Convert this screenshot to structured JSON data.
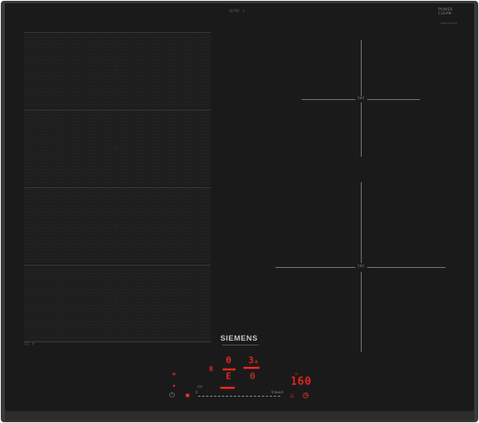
{
  "top_small_label": "iQ700 · s",
  "top_right_logo": {
    "line1": "POWER",
    "line2": "CLEAN"
  },
  "top_right_small": "EX675LYV1E",
  "flex_zone_marks": {
    "left": "|||",
    "right": "/⁄‑"
  },
  "zone_marks": {
    "upper": "(≡)",
    "lower": "(≡)"
  },
  "brand": "SIEMENS",
  "displays": {
    "left_zone_level": "8",
    "upper_zone_level": "0",
    "upper_right_level": "3",
    "upper_right_sub": "a",
    "middle_level": "E",
    "middle_right_level": "0",
    "timer": "160"
  },
  "control_icons": {
    "plus": "+",
    "dot": "•",
    "power": "⏻",
    "lock": "✱",
    "flex": "▭",
    "pan": "♨",
    "timer_clock": "◷",
    "settings": "⚙"
  },
  "slider": {
    "min_label": "0",
    "max_label": "9 boost"
  },
  "colors": {
    "display_red": "#ff2a20",
    "glass": "#1a1a1a",
    "frame": "#3a3a3a",
    "brand_text": "#c8c8c8"
  }
}
